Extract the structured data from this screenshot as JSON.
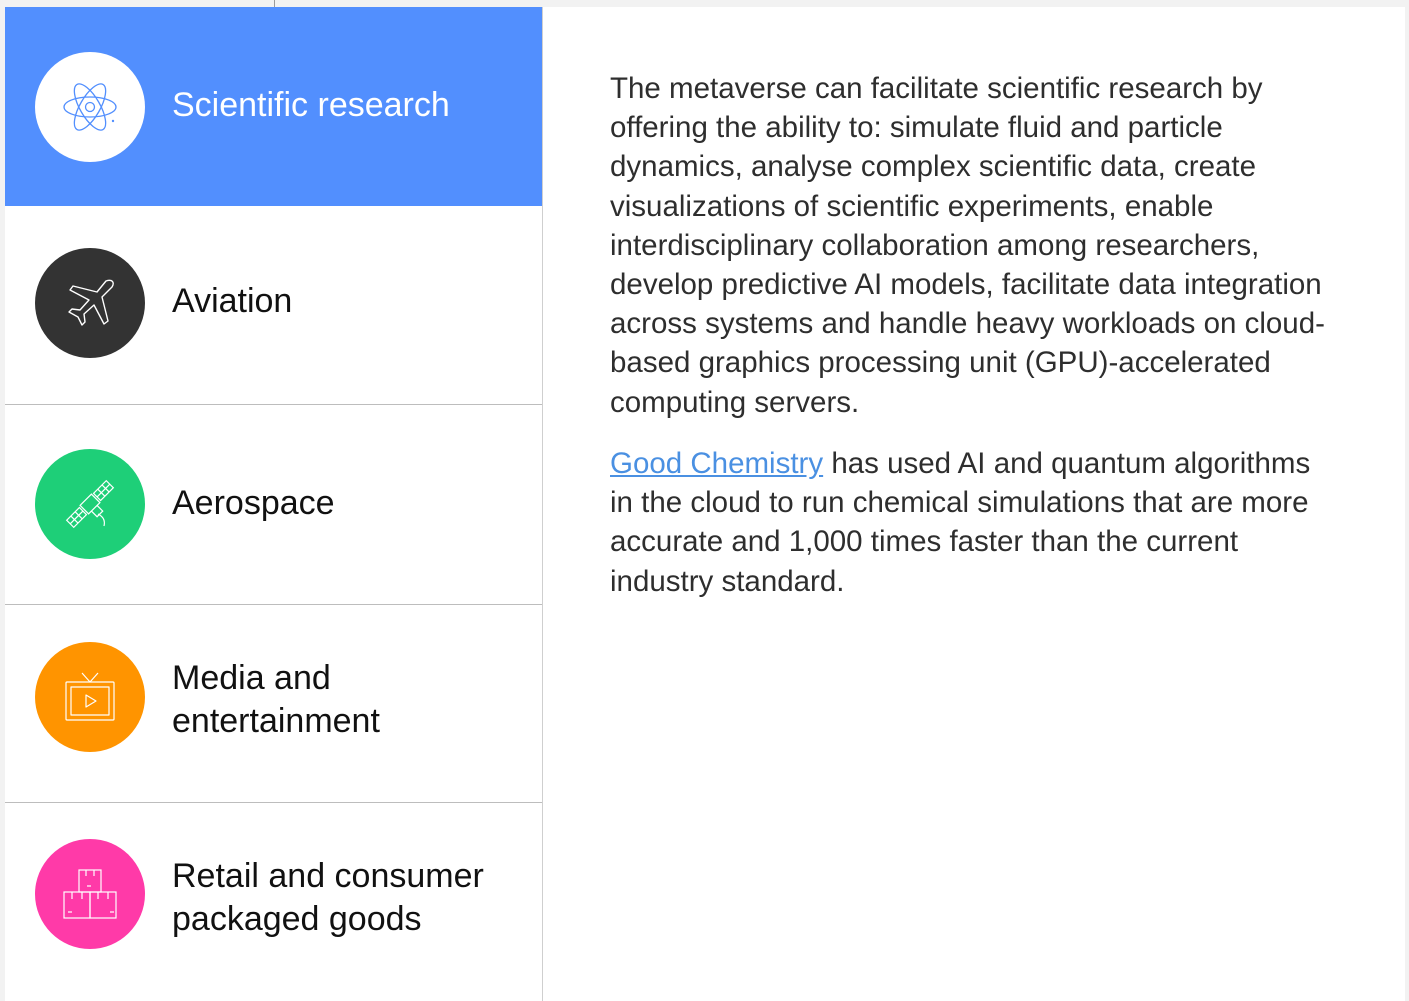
{
  "tabs": [
    {
      "label": "Scientific research",
      "icon": "atom-icon",
      "color": "#ffffff",
      "active": true
    },
    {
      "label": "Aviation",
      "icon": "airplane-icon",
      "color": "#333333",
      "active": false
    },
    {
      "label": "Aerospace",
      "icon": "satellite-icon",
      "color": "#1ecf78",
      "active": false
    },
    {
      "label": "Media and entertainment",
      "icon": "tv-icon",
      "color": "#ff9400",
      "active": false
    },
    {
      "label": "Retail and consumer packaged goods",
      "icon": "boxes-icon",
      "color": "#ff3aa8",
      "active": false
    }
  ],
  "active_tab_color": "#528ffe",
  "content": {
    "paragraph1": "The metaverse can facilitate scientific research by offering the ability to: simulate fluid and particle dynamics, analyse complex scientific data, create visualizations of scientific experiments, enable interdisciplinary collaboration among researchers, develop predictive AI models, facilitate data integration across systems and handle heavy workloads on cloud-based graphics processing unit (GPU)-accelerated computing servers.",
    "link_text": "Good Chemistry",
    "paragraph2_rest": " has used AI and quantum algorithms in the cloud to run chemical simulations that are more accurate and 1,000 times faster than the current industry standard.",
    "link_color": "#4a90e2"
  }
}
